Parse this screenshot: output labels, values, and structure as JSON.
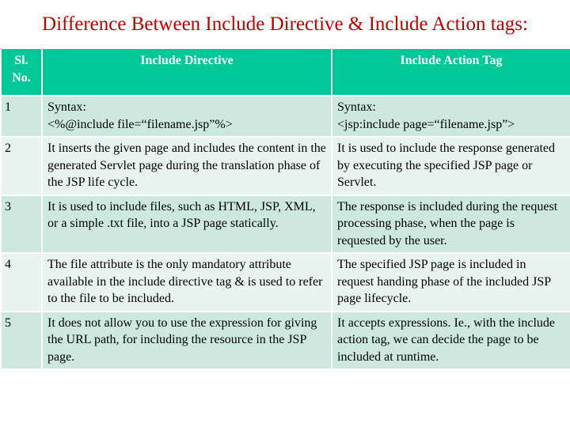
{
  "title": "Difference Between Include Directive & Include Action tags:",
  "colors": {
    "title": "#c00000",
    "header_bg": "#00c896",
    "row_dark": "#cde9df",
    "row_light": "#e7f4ef"
  },
  "table": {
    "headers": {
      "sl": "Sl. No.",
      "directive": "Include Directive",
      "action": "Include Action Tag"
    },
    "rows": [
      {
        "sl": "1",
        "directive": "Syntax:\n<%@include file=“filename.jsp”%>",
        "action": "Syntax:\n<jsp:include page=“filename.jsp”>"
      },
      {
        "sl": "2",
        "directive": "It inserts the given page and includes the content in the generated Servlet page during the translation phase of the JSP life cycle.",
        "action": "It is used to include the response generated by executing the specified JSP page or Servlet."
      },
      {
        "sl": "3",
        "directive": "It is used to include files, such as HTML, JSP, XML, or a simple .txt file, into a JSP page statically.",
        "action": "The response is included during the request processing phase, when the page is requested by the user."
      },
      {
        "sl": "4",
        "directive": "The file attribute is the only mandatory attribute available in the include directive tag & is used to refer to the file to be included.",
        "action": "The specified JSP page is included in request handing phase of the included JSP page lifecycle."
      },
      {
        "sl": "5",
        "directive": "It does not allow you to use the expression for giving the URL path, for including the resource in the JSP page.",
        "action": "It accepts expressions. Ie., with the include action tag, we can decide the page to be included at runtime."
      }
    ]
  }
}
